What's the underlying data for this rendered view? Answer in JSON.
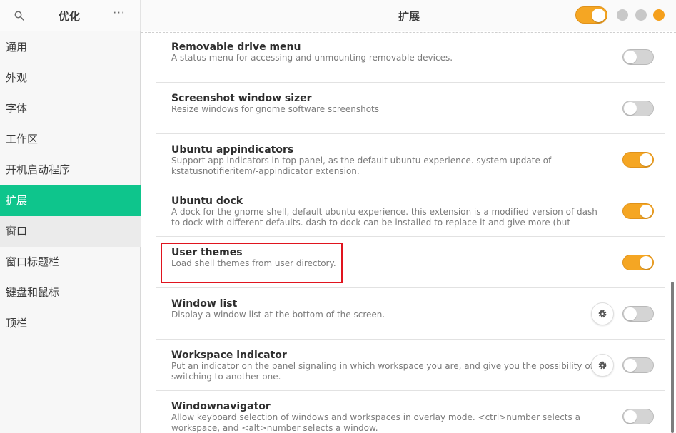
{
  "header": {
    "app_title": "优化",
    "more_label": "···",
    "page_title": "扩展",
    "global_switch_on": true
  },
  "sidebar": {
    "items": [
      {
        "label": "通用"
      },
      {
        "label": "外观"
      },
      {
        "label": "字体"
      },
      {
        "label": "工作区"
      },
      {
        "label": "开机启动程序"
      },
      {
        "label": "扩展"
      },
      {
        "label": "窗口"
      },
      {
        "label": "窗口标题栏"
      },
      {
        "label": "键盘和鼠标"
      },
      {
        "label": "顶栏"
      }
    ],
    "selected": "扩展"
  },
  "extensions": [
    {
      "name": "Removable drive menu",
      "desc": "A status menu for accessing and unmounting removable devices.",
      "enabled": false,
      "has_settings": false
    },
    {
      "name": "Screenshot window sizer",
      "desc": "Resize windows for gnome software screenshots",
      "enabled": false,
      "has_settings": false
    },
    {
      "name": "Ubuntu appindicators",
      "desc": "Support app indicators in top panel, as the default ubuntu experience. system update of kstatusnotifieritem/-appindicator extension.",
      "enabled": true,
      "has_settings": false
    },
    {
      "name": "Ubuntu dock",
      "desc": "A dock for the gnome shell, default ubuntu experience. this extension is a modified version of dash to dock with different defaults. dash to dock can be installed to replace it and give more (but unsupported) configur…",
      "enabled": true,
      "has_settings": false
    },
    {
      "name": "User themes",
      "desc": "Load shell themes from user directory.",
      "enabled": true,
      "has_settings": false
    },
    {
      "name": "Window list",
      "desc": "Display a window list at the bottom of the screen.",
      "enabled": false,
      "has_settings": true
    },
    {
      "name": "Workspace indicator",
      "desc": "Put an indicator on the panel signaling in which workspace you are, and give you the possibility of switching to another one.",
      "enabled": false,
      "has_settings": true
    },
    {
      "name": "Windownavigator",
      "desc": "Allow keyboard selection of windows and workspaces in overlay mode. <ctrl>number selects a workspace, and <alt>number selects a window.",
      "enabled": false,
      "has_settings": false
    }
  ],
  "colors": {
    "accent_selected": "#0ec58c",
    "switch_on": "#f5a623",
    "highlight": "#e0141e"
  }
}
